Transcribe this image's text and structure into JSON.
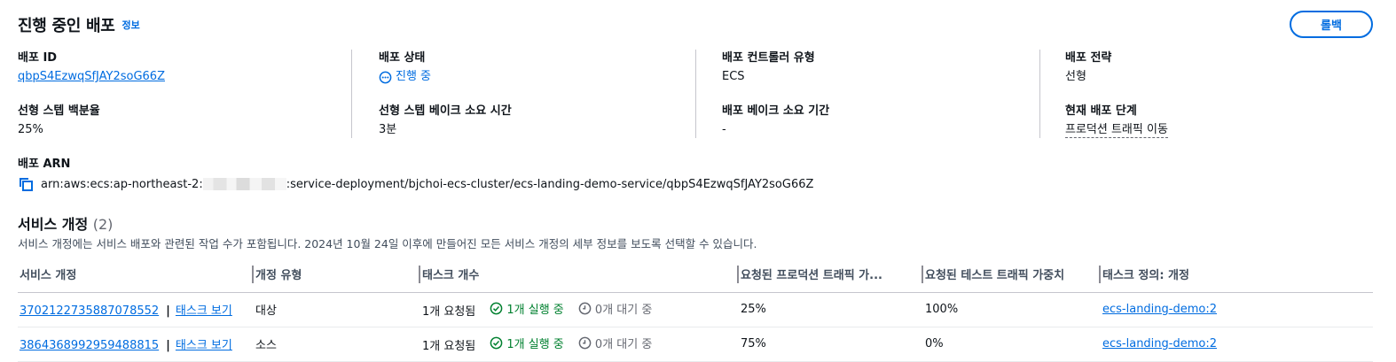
{
  "header": {
    "title": "진행 중인 배포",
    "info_link": "정보",
    "rollback_label": "롤백"
  },
  "details": {
    "deployment_id": {
      "label": "배포 ID",
      "value": "qbpS4EzwqSfJAY2soG66Z"
    },
    "deployment_status": {
      "label": "배포 상태",
      "value": "진행 중"
    },
    "controller_type": {
      "label": "배포 컨트롤러 유형",
      "value": "ECS"
    },
    "strategy": {
      "label": "배포 전략",
      "value": "선형"
    },
    "linear_step_percent": {
      "label": "선형 스텝 백분율",
      "value": "25%"
    },
    "linear_step_bake_time": {
      "label": "선형 스텝 베이크 소요 시간",
      "value": "3분"
    },
    "bake_time": {
      "label": "배포 베이크 소요 기간",
      "value": "-"
    },
    "current_stage": {
      "label": "현재 배포 단계",
      "value": "프로덕션 트래픽 이동"
    },
    "arn": {
      "label": "배포 ARN",
      "prefix": "arn:aws:ecs:ap-northeast-2:",
      "suffix": ":service-deployment/bjchoi-ecs-cluster/ecs-landing-demo-service/qbpS4EzwqSfJAY2soG66Z"
    }
  },
  "revisions": {
    "title": "서비스 개정",
    "count": "(2)",
    "description": "서비스 개정에는 서비스 배포와 관련된 작업 수가 포함됩니다. 2024년 10월 24일 이후에 만들어진 모든 서비스 개정의 세부 정보를 보도록 선택할 수 있습니다.",
    "columns": [
      "서비스 개정",
      "개정 유형",
      "태스크 개수",
      "요청된 프로덕션 트래픽 가...",
      "요청된 테스트 트래픽 가중치",
      "태스크 정의: 개정"
    ],
    "rows": [
      {
        "revision_id": "3702122735887078552",
        "view_tasks": "태스크 보기",
        "type": "대상",
        "requested": "1개 요청됨",
        "running": "1개 실행 중",
        "pending": "0개 대기 중",
        "prod_weight": "25%",
        "test_weight": "100%",
        "task_def": "ecs-landing-demo:2"
      },
      {
        "revision_id": "3864368992959488815",
        "view_tasks": "태스크 보기",
        "type": "소스",
        "requested": "1개 요청됨",
        "running": "1개 실행 중",
        "pending": "0개 대기 중",
        "prod_weight": "75%",
        "test_weight": "0%",
        "task_def": "ecs-landing-demo:2"
      }
    ]
  },
  "colors": {
    "link": "#006ce0",
    "success": "#00802f",
    "muted": "#656871",
    "text": "#0f141a"
  }
}
